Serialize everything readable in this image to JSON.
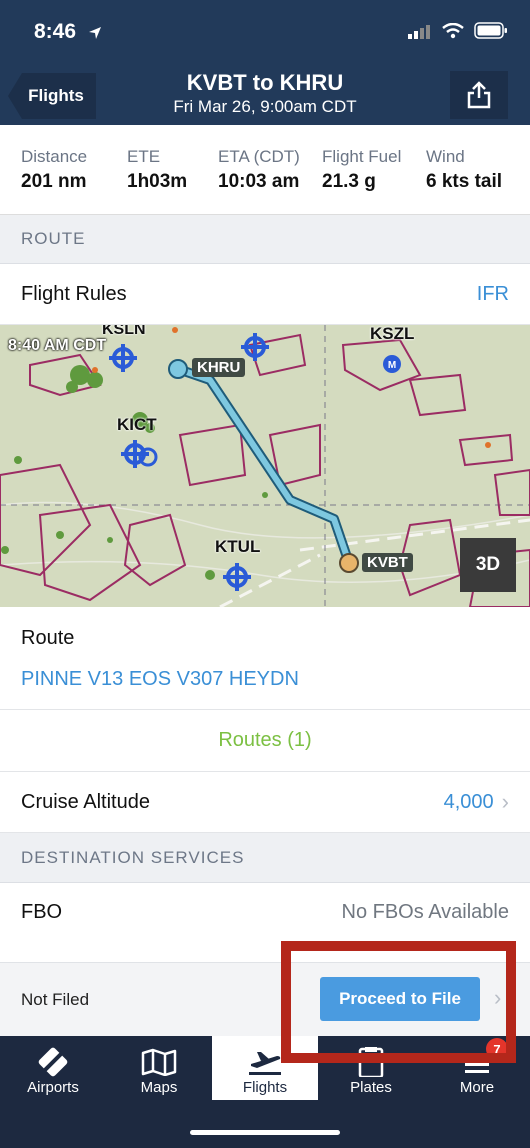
{
  "status": {
    "time": "8:46"
  },
  "nav": {
    "back_label": "Flights",
    "title": "KVBT to KHRU",
    "subtitle": "Fri Mar 26, 9:00am CDT"
  },
  "stats": [
    {
      "label": "Distance",
      "value": "201 nm"
    },
    {
      "label": "ETE",
      "value": "1h03m"
    },
    {
      "label": "ETA (CDT)",
      "value": "10:03 am"
    },
    {
      "label": "Flight Fuel",
      "value": "21.3 g"
    },
    {
      "label": "Wind",
      "value": "6 kts tail"
    }
  ],
  "route_section": {
    "header": "ROUTE",
    "flight_rules_label": "Flight Rules",
    "flight_rules_value": "IFR"
  },
  "map": {
    "timestamp": "8:40 AM CDT",
    "labels": [
      "KSLN",
      "KSZL",
      "KHRU",
      "KICT",
      "KTUL",
      "KVBT"
    ],
    "button_3d": "3D"
  },
  "route": {
    "label": "Route",
    "value": "PINNE V13 EOS V307 HEYDN",
    "routes_link": "Routes (1)"
  },
  "cruise": {
    "label": "Cruise Altitude",
    "value": "4,000"
  },
  "destination_section": {
    "header": "DESTINATION SERVICES",
    "fbo_label": "FBO",
    "fbo_value": "No FBOs Available"
  },
  "filing": {
    "status": "Not Filed",
    "proceed_label": "Proceed to File"
  },
  "tabs": [
    {
      "label": "Airports",
      "icon": "airports-icon"
    },
    {
      "label": "Maps",
      "icon": "maps-icon"
    },
    {
      "label": "Flights",
      "icon": "flights-icon",
      "active": true
    },
    {
      "label": "Plates",
      "icon": "plates-icon"
    },
    {
      "label": "More",
      "icon": "more-icon",
      "badge": "7"
    }
  ],
  "colors": {
    "header_bg": "#223a5a",
    "tabbar_bg": "#1d2940",
    "link_blue": "#3a8fd6",
    "routes_green": "#7cc043",
    "highlight_red": "#b4271b"
  }
}
